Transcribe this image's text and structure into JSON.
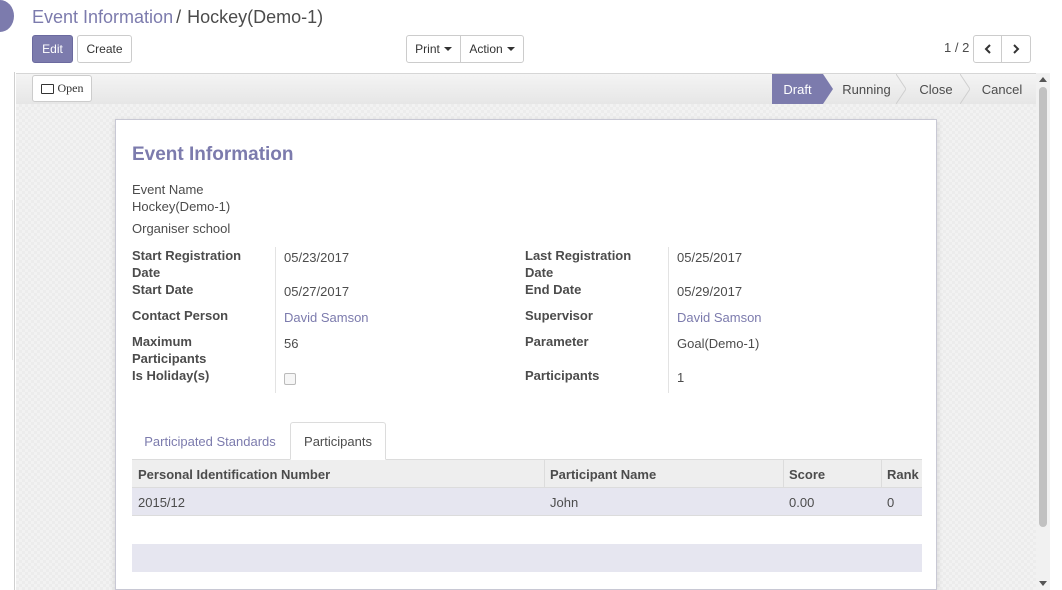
{
  "breadcrumb": {
    "parent": "Event Information",
    "separator": "/",
    "current": "Hockey(Demo-1)"
  },
  "toolbar": {
    "edit_label": "Edit",
    "create_label": "Create",
    "print_label": "Print",
    "action_label": "Action"
  },
  "pager": {
    "text": "1 / 2"
  },
  "statusbar": {
    "open_label": "Open",
    "stages": [
      "Draft",
      "Running",
      "Close",
      "Cancel"
    ],
    "active_stage": "Draft"
  },
  "form": {
    "title": "Event Information",
    "event_name_label": "Event Name",
    "event_name_value": "Hockey(Demo-1)",
    "organiser": "Organiser school",
    "left_fields": {
      "start_registration_label": "Start Registration Date",
      "start_registration_value": "05/23/2017",
      "start_date_label": "Start Date",
      "start_date_value": "05/27/2017",
      "contact_person_label": "Contact Person",
      "contact_person_value": "David Samson",
      "max_participants_label": "Maximum Participants",
      "max_participants_value": "56",
      "is_holiday_label": "Is Holiday(s)",
      "is_holiday_checked": false
    },
    "right_fields": {
      "last_registration_label": "Last Registration Date",
      "last_registration_value": "05/25/2017",
      "end_date_label": "End Date",
      "end_date_value": "05/29/2017",
      "supervisor_label": "Supervisor",
      "supervisor_value": "David Samson",
      "parameter_label": "Parameter",
      "parameter_value": "Goal(Demo-1)",
      "participants_label": "Participants",
      "participants_value": "1"
    }
  },
  "tabs": [
    {
      "label": "Participated Standards",
      "active": false
    },
    {
      "label": "Participants",
      "active": true
    }
  ],
  "table": {
    "headers": [
      "Personal Identification Number",
      "Participant Name",
      "Score",
      "Rank"
    ],
    "rows": [
      [
        "2015/12",
        "John",
        "0.00",
        "0"
      ]
    ]
  },
  "colors": {
    "accent": "#7c7bad"
  }
}
